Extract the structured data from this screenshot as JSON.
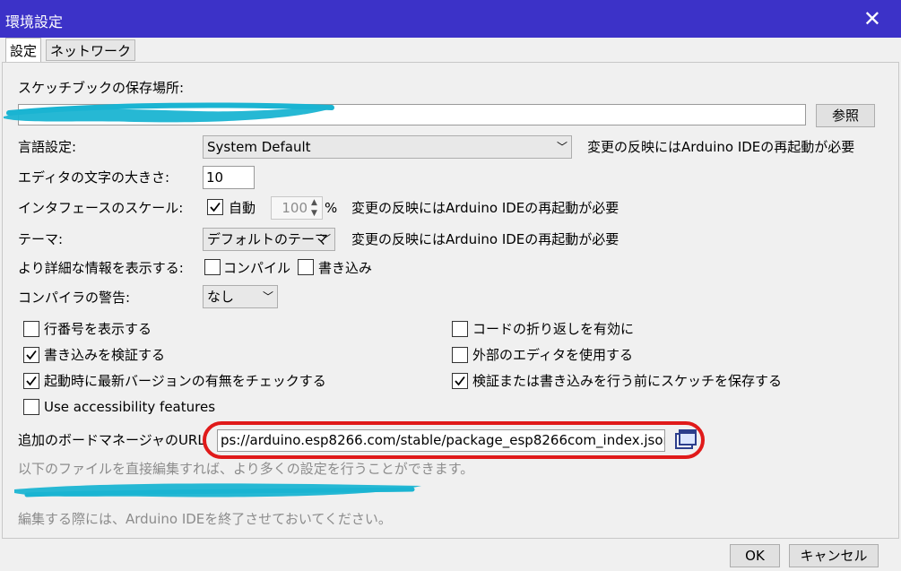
{
  "window": {
    "title": "環境設定",
    "close_glyph": "✕"
  },
  "tabs": [
    {
      "label": "設定",
      "active": true
    },
    {
      "label": "ネットワーク",
      "active": false
    }
  ],
  "sketchbook": {
    "label": "スケッチブックの保存場所:",
    "path": "",
    "browse_label": "参照"
  },
  "language": {
    "label": "言語設定:",
    "value": "System Default",
    "note": "変更の反映にはArduino IDEの再起動が必要"
  },
  "font_size": {
    "label": "エディタの文字の大きさ:",
    "value": "10"
  },
  "scale": {
    "label": "インタフェースのスケール:",
    "auto_label": "自動",
    "auto_checked": true,
    "value": "100",
    "unit": "%",
    "note": "変更の反映にはArduino IDEの再起動が必要"
  },
  "theme": {
    "label": "テーマ:",
    "value": "デフォルトのテーマ",
    "note": "変更の反映にはArduino IDEの再起動が必要"
  },
  "verbose": {
    "label": "より詳細な情報を表示する:",
    "compile_label": "コンパイル",
    "compile_checked": false,
    "upload_label": "書き込み",
    "upload_checked": false
  },
  "warnings": {
    "label": "コンパイラの警告:",
    "value": "なし"
  },
  "options": {
    "line_numbers": {
      "label": "行番号を表示する",
      "checked": false
    },
    "code_folding": {
      "label": "コードの折り返しを有効に",
      "checked": false
    },
    "verify_upload": {
      "label": "書き込みを検証する",
      "checked": true
    },
    "external_editor": {
      "label": "外部のエディタを使用する",
      "checked": false
    },
    "check_updates": {
      "label": "起動時に最新バージョンの有無をチェックする",
      "checked": true
    },
    "save_before": {
      "label": "検証または書き込みを行う前にスケッチを保存する",
      "checked": true
    },
    "accessibility": {
      "label": "Use accessibility features",
      "checked": false
    }
  },
  "board_manager": {
    "label": "追加のボードマネージャのURL",
    "url": "ps://arduino.esp8266.com/stable/package_esp8266com_index.json"
  },
  "notes": {
    "edit_file": "以下のファイルを直接編集すれば、より多くの設定を行うことができます。",
    "quit_ide": "編集する際には、Arduino IDEを終了させておいてください。"
  },
  "footer": {
    "ok_label": "OK",
    "cancel_label": "キャンセル"
  },
  "colors": {
    "titlebar": "#3c32c8",
    "annotation_red": "#e01a1a",
    "annotation_blue": "#1ab4d2"
  }
}
